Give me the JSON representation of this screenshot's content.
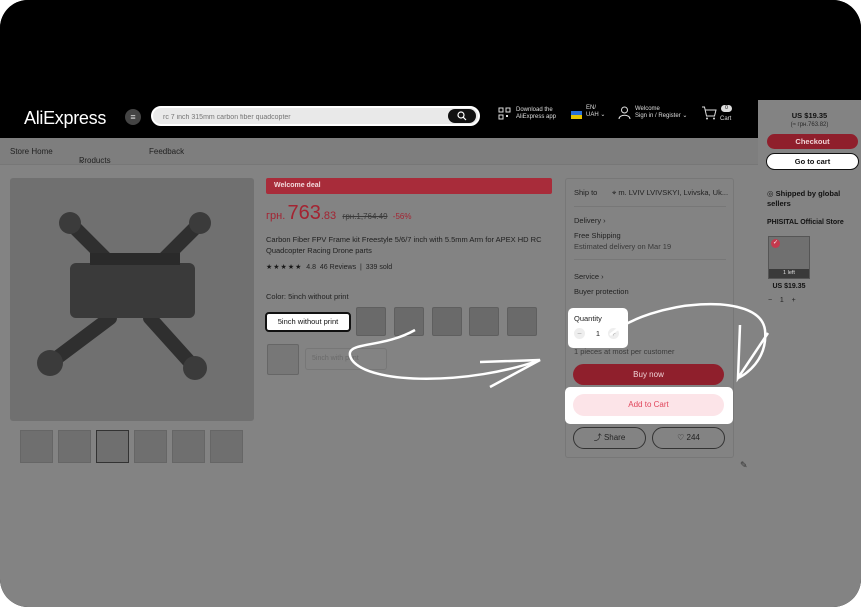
{
  "header": {
    "logo": "AliExpress",
    "search_placeholder": "rc 7 inch 315mm carbon fiber quadcopter",
    "app_line1": "Download the",
    "app_line2": "AliExpress app",
    "lang_line1": "EN/",
    "lang_line2": "UAH",
    "account_line1": "Welcome",
    "account_line2": "Sign in / Register",
    "cart_label": "Cart",
    "cart_count": "0"
  },
  "store_nav": {
    "items": [
      "Store Home",
      "Products",
      "Feedback"
    ]
  },
  "product": {
    "welcome_deal": "Welcome deal",
    "price_currency": "грн.",
    "price_main": "763",
    "price_decimal": ".83",
    "price_old": "грн.1,764.49",
    "discount": "-56%",
    "title": "Carbon Fiber FPV Frame kit Freestyle 5/6/7 inch with 5.5mm Arm for APEX HD RC Quadcopter Racing Drone parts",
    "stars": "★★★★★",
    "rating": "4.8",
    "reviews": "46 Reviews",
    "sold": "339 sold",
    "color_label": "Color: 5inch without print",
    "selected_variant": "5inch without print",
    "other_variant": "5inch with print"
  },
  "purchase_panel": {
    "ship_to_label": "Ship to",
    "ship_to_value": "m. LVIV LVIVSKYI, Lvivska, Uk...",
    "delivery_label": "Delivery",
    "delivery_free": "Free Shipping",
    "delivery_est": "Estimated delivery on Mar 19",
    "service_label": "Service",
    "service_value": "Buyer protection",
    "quantity_label": "Quantity",
    "quantity_value": "1",
    "quantity_note": "1 pieces at most per customer",
    "buy_now": "Buy now",
    "add_to_cart": "Add to Cart",
    "share": "Share",
    "likes": "244"
  },
  "right_sidebar": {
    "total": "US $19.35",
    "total_sub": "(≈ грн.763.82)",
    "checkout": "Checkout",
    "go_to_cart": "Go to cart",
    "shipped_by": "Shipped by global sellers",
    "store_name": "PHISITAL Official Store",
    "item_left": "1 left",
    "item_price": "US $19.35",
    "item_qty": "1"
  },
  "icons": {
    "search": "search-icon",
    "menu": "menu-icon",
    "qr": "qr-code-icon",
    "user": "user-icon",
    "cart": "cart-icon",
    "pin": "location-pin-icon",
    "share": "share-icon",
    "heart": "heart-icon",
    "edit": "edit-icon"
  },
  "colors": {
    "brand_red": "#a82c3a",
    "price_red": "#a32432",
    "add_cart_text": "#e0455b",
    "add_cart_bg": "#fce4e8"
  }
}
